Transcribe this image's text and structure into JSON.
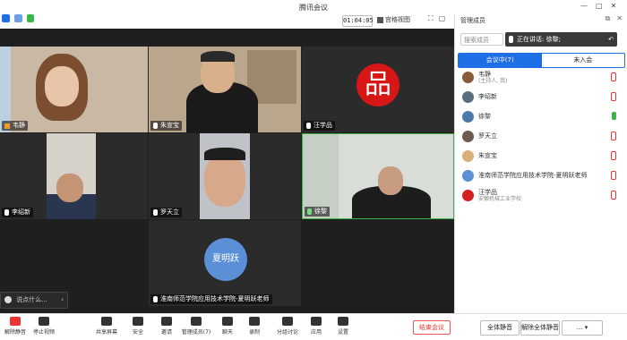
{
  "window": {
    "title": "腾讯会议",
    "timer": "01:04:05",
    "view_label": "宫格视图"
  },
  "stage": {
    "chat_placeholder": "说点什么...",
    "tiles": [
      {
        "name": "韦静",
        "kind": "video"
      },
      {
        "name": "朱宣宝",
        "kind": "video"
      },
      {
        "name": "汪学品",
        "kind": "logo",
        "logo_text": "品"
      },
      {
        "name": "李绍新",
        "kind": "video"
      },
      {
        "name": "罗天立",
        "kind": "video"
      },
      {
        "name": "徐黎",
        "kind": "video"
      },
      {
        "name": "淮南师范学院应用技术学院-夏明跃老师",
        "kind": "avatar",
        "avatar_text": "夏明跃"
      }
    ]
  },
  "sidebar": {
    "title": "管理成员",
    "search_placeholder": "搜索成员",
    "speaking_label": "正在讲话: 徐黎;",
    "tabs": [
      "会议中(7)",
      "未入会"
    ],
    "members": [
      {
        "name": "韦静",
        "sub": "(主持人, 我)",
        "avatar_color": "#8a5a3c",
        "mic": "muted"
      },
      {
        "name": "李绍新",
        "sub": "",
        "avatar_color": "#5a6d80",
        "mic": "muted"
      },
      {
        "name": "徐黎",
        "sub": "",
        "avatar_color": "#4c7aa8",
        "mic": "on"
      },
      {
        "name": "罗天立",
        "sub": "",
        "avatar_color": "#6e5a4e",
        "mic": "muted"
      },
      {
        "name": "朱宣宝",
        "sub": "",
        "avatar_color": "#d9b07a",
        "mic": "muted"
      },
      {
        "name": "淮南师范学院应用技术学院-夏明跃老师",
        "sub": "",
        "avatar_color": "#5b8fd6",
        "mic": "muted"
      },
      {
        "name": "汪学品",
        "sub": "安徽机械工业学校",
        "avatar_color": "#d42020",
        "mic": "muted"
      }
    ],
    "footer": {
      "mute_all": "全体静音",
      "unmute_all": "解除全体静音",
      "more": "..."
    }
  },
  "toolbar": {
    "buttons": [
      {
        "label": "解除静音",
        "icon": "mic-muted-icon"
      },
      {
        "label": "停止视频",
        "icon": "camera-icon"
      },
      {
        "label": "共享屏幕",
        "icon": "share-screen-icon"
      },
      {
        "label": "安全",
        "icon": "shield-icon"
      },
      {
        "label": "邀请",
        "icon": "invite-icon"
      },
      {
        "label": "管理成员(7)",
        "icon": "members-icon"
      },
      {
        "label": "聊天",
        "icon": "chat-icon"
      },
      {
        "label": "录制",
        "icon": "record-icon"
      },
      {
        "label": "分组讨论",
        "icon": "breakout-icon"
      },
      {
        "label": "应用",
        "icon": "apps-icon"
      },
      {
        "label": "设置",
        "icon": "settings-icon"
      }
    ],
    "leave_label": "结束会议"
  },
  "colors": {
    "accent": "#1e6fe6",
    "danger": "#e33333",
    "stage_bg": "#1f1f1f",
    "logo_red": "#d71616"
  }
}
